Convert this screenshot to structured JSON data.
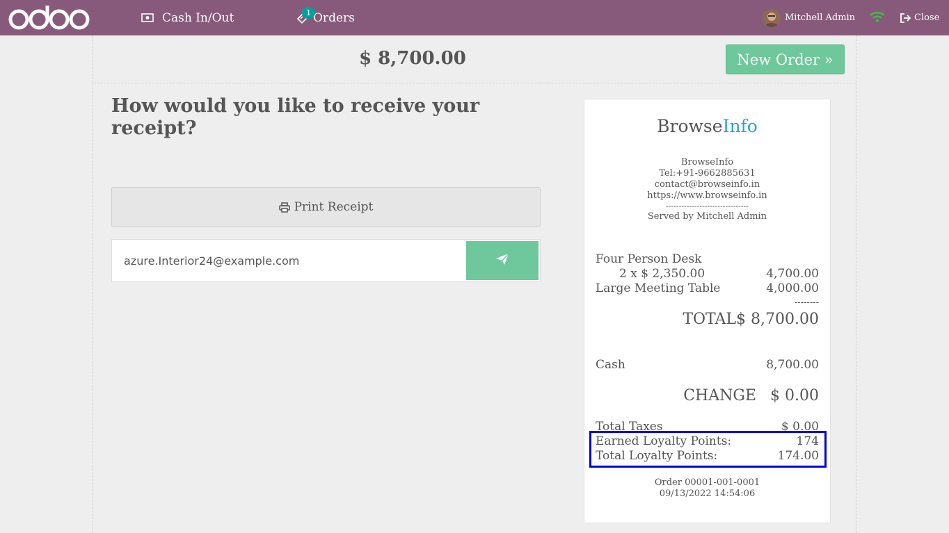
{
  "topbar": {
    "brand": "odoo",
    "cash_label": "Cash In/Out",
    "orders_label": "Orders",
    "orders_badge": "1",
    "user_name": "Mitchell Admin",
    "close_label": "Close",
    "bg_color": "#875a7b"
  },
  "payment": {
    "total": "$ 8,700.00",
    "new_order_label": "New Order »",
    "question": "How would you like to receive your receipt?",
    "print_label": "Print Receipt",
    "email_value": "azure.Interior24@example.com"
  },
  "receipt": {
    "brand_main": "Browse",
    "brand_accent": "Info",
    "company": "BrowseInfo",
    "tel": "Tel:+91-9662885631",
    "email": "contact@browseinfo.in",
    "website": "https://www.browseinfo.in",
    "separator": "--------------------------------",
    "served_by": "Served by Mitchell Admin",
    "lines": [
      {
        "name": "Four Person Desk",
        "detail": "2 x $ 2,350.00",
        "amount": "4,700.00"
      },
      {
        "name": "Large Meeting Table",
        "amount": "4,000.00"
      }
    ],
    "sum_separator": "--------",
    "total_label": "TOTAL",
    "total_value": "$ 8,700.00",
    "payment_method": "Cash",
    "payment_amount": "8,700.00",
    "change_label": "CHANGE",
    "change_value": "$ 0.00",
    "taxes_label": "Total Taxes",
    "taxes_value": "$ 0.00",
    "earned_label": "Earned Loyalty Points:",
    "earned_value": "174",
    "total_points_label": "Total Loyalty Points:",
    "total_points_value": "174.00",
    "order_ref": "Order 00001-001-0001",
    "order_date": "09/13/2022 14:54:06"
  }
}
